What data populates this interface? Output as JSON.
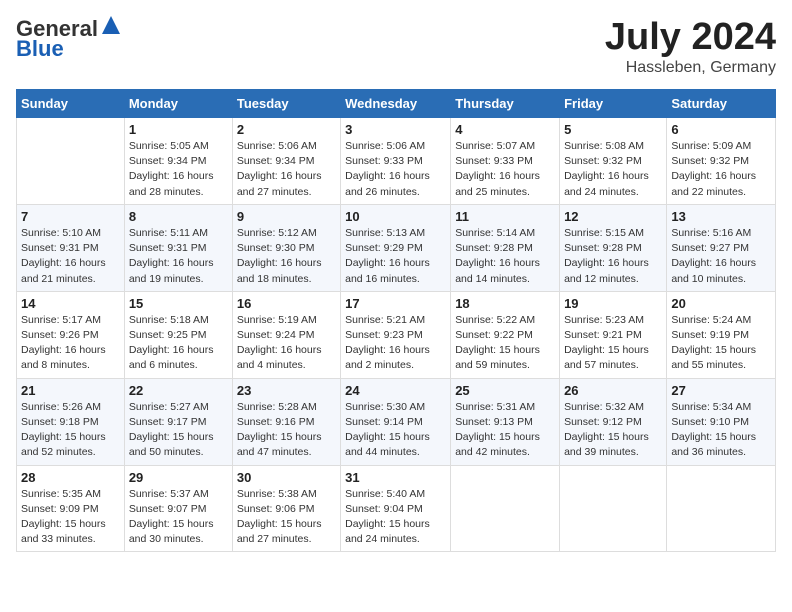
{
  "header": {
    "logo_general": "General",
    "logo_blue": "Blue",
    "month_year": "July 2024",
    "location": "Hassleben, Germany"
  },
  "weekdays": [
    "Sunday",
    "Monday",
    "Tuesday",
    "Wednesday",
    "Thursday",
    "Friday",
    "Saturday"
  ],
  "weeks": [
    [
      {
        "day": "",
        "info": ""
      },
      {
        "day": "1",
        "info": "Sunrise: 5:05 AM\nSunset: 9:34 PM\nDaylight: 16 hours\nand 28 minutes."
      },
      {
        "day": "2",
        "info": "Sunrise: 5:06 AM\nSunset: 9:34 PM\nDaylight: 16 hours\nand 27 minutes."
      },
      {
        "day": "3",
        "info": "Sunrise: 5:06 AM\nSunset: 9:33 PM\nDaylight: 16 hours\nand 26 minutes."
      },
      {
        "day": "4",
        "info": "Sunrise: 5:07 AM\nSunset: 9:33 PM\nDaylight: 16 hours\nand 25 minutes."
      },
      {
        "day": "5",
        "info": "Sunrise: 5:08 AM\nSunset: 9:32 PM\nDaylight: 16 hours\nand 24 minutes."
      },
      {
        "day": "6",
        "info": "Sunrise: 5:09 AM\nSunset: 9:32 PM\nDaylight: 16 hours\nand 22 minutes."
      }
    ],
    [
      {
        "day": "7",
        "info": "Sunrise: 5:10 AM\nSunset: 9:31 PM\nDaylight: 16 hours\nand 21 minutes."
      },
      {
        "day": "8",
        "info": "Sunrise: 5:11 AM\nSunset: 9:31 PM\nDaylight: 16 hours\nand 19 minutes."
      },
      {
        "day": "9",
        "info": "Sunrise: 5:12 AM\nSunset: 9:30 PM\nDaylight: 16 hours\nand 18 minutes."
      },
      {
        "day": "10",
        "info": "Sunrise: 5:13 AM\nSunset: 9:29 PM\nDaylight: 16 hours\nand 16 minutes."
      },
      {
        "day": "11",
        "info": "Sunrise: 5:14 AM\nSunset: 9:28 PM\nDaylight: 16 hours\nand 14 minutes."
      },
      {
        "day": "12",
        "info": "Sunrise: 5:15 AM\nSunset: 9:28 PM\nDaylight: 16 hours\nand 12 minutes."
      },
      {
        "day": "13",
        "info": "Sunrise: 5:16 AM\nSunset: 9:27 PM\nDaylight: 16 hours\nand 10 minutes."
      }
    ],
    [
      {
        "day": "14",
        "info": "Sunrise: 5:17 AM\nSunset: 9:26 PM\nDaylight: 16 hours\nand 8 minutes."
      },
      {
        "day": "15",
        "info": "Sunrise: 5:18 AM\nSunset: 9:25 PM\nDaylight: 16 hours\nand 6 minutes."
      },
      {
        "day": "16",
        "info": "Sunrise: 5:19 AM\nSunset: 9:24 PM\nDaylight: 16 hours\nand 4 minutes."
      },
      {
        "day": "17",
        "info": "Sunrise: 5:21 AM\nSunset: 9:23 PM\nDaylight: 16 hours\nand 2 minutes."
      },
      {
        "day": "18",
        "info": "Sunrise: 5:22 AM\nSunset: 9:22 PM\nDaylight: 15 hours\nand 59 minutes."
      },
      {
        "day": "19",
        "info": "Sunrise: 5:23 AM\nSunset: 9:21 PM\nDaylight: 15 hours\nand 57 minutes."
      },
      {
        "day": "20",
        "info": "Sunrise: 5:24 AM\nSunset: 9:19 PM\nDaylight: 15 hours\nand 55 minutes."
      }
    ],
    [
      {
        "day": "21",
        "info": "Sunrise: 5:26 AM\nSunset: 9:18 PM\nDaylight: 15 hours\nand 52 minutes."
      },
      {
        "day": "22",
        "info": "Sunrise: 5:27 AM\nSunset: 9:17 PM\nDaylight: 15 hours\nand 50 minutes."
      },
      {
        "day": "23",
        "info": "Sunrise: 5:28 AM\nSunset: 9:16 PM\nDaylight: 15 hours\nand 47 minutes."
      },
      {
        "day": "24",
        "info": "Sunrise: 5:30 AM\nSunset: 9:14 PM\nDaylight: 15 hours\nand 44 minutes."
      },
      {
        "day": "25",
        "info": "Sunrise: 5:31 AM\nSunset: 9:13 PM\nDaylight: 15 hours\nand 42 minutes."
      },
      {
        "day": "26",
        "info": "Sunrise: 5:32 AM\nSunset: 9:12 PM\nDaylight: 15 hours\nand 39 minutes."
      },
      {
        "day": "27",
        "info": "Sunrise: 5:34 AM\nSunset: 9:10 PM\nDaylight: 15 hours\nand 36 minutes."
      }
    ],
    [
      {
        "day": "28",
        "info": "Sunrise: 5:35 AM\nSunset: 9:09 PM\nDaylight: 15 hours\nand 33 minutes."
      },
      {
        "day": "29",
        "info": "Sunrise: 5:37 AM\nSunset: 9:07 PM\nDaylight: 15 hours\nand 30 minutes."
      },
      {
        "day": "30",
        "info": "Sunrise: 5:38 AM\nSunset: 9:06 PM\nDaylight: 15 hours\nand 27 minutes."
      },
      {
        "day": "31",
        "info": "Sunrise: 5:40 AM\nSunset: 9:04 PM\nDaylight: 15 hours\nand 24 minutes."
      },
      {
        "day": "",
        "info": ""
      },
      {
        "day": "",
        "info": ""
      },
      {
        "day": "",
        "info": ""
      }
    ]
  ]
}
